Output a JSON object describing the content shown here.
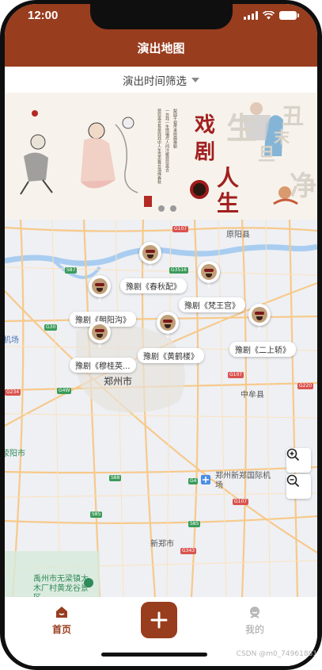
{
  "status_bar": {
    "time": "12:00"
  },
  "header": {
    "title": "演出地图"
  },
  "filter": {
    "label": "演出时间筛选"
  },
  "banner": {
    "title_chars": [
      "戏",
      "剧",
      "人",
      "生"
    ],
    "carousel_pages": 3,
    "active_page": 1
  },
  "map": {
    "place_labels": [
      {
        "name": "原阳县",
        "kind": "town"
      },
      {
        "name": "郑州市",
        "kind": "city"
      },
      {
        "name": "中牟县",
        "kind": "town"
      },
      {
        "name": "郑州新郑国际机场",
        "kind": "airport"
      },
      {
        "name": "新郑市",
        "kind": "town"
      },
      {
        "name": "禹州市无梁镇大木厂村黄龙谷景区",
        "kind": "scenic"
      },
      {
        "name": "荥阳市",
        "kind": "edge"
      },
      {
        "name": "机场",
        "kind": "edge"
      }
    ],
    "markers": [
      {
        "label": "豫剧《春秋配》"
      },
      {
        "label": "豫剧《梵王宫》"
      },
      {
        "label": "豫剧《朝阳沟》"
      },
      {
        "label": "豫剧《二上轿》"
      },
      {
        "label": "豫剧《黄鹤楼》"
      },
      {
        "label": "豫剧《穆桂英..."
      }
    ],
    "zoom_in_icon": "zoom-in-icon",
    "zoom_out_icon": "zoom-out-icon"
  },
  "tabbar": {
    "home_label": "首页",
    "add_icon": "plus-icon",
    "me_label": "我的"
  },
  "watermark": "CSDN @m0_74961881",
  "colors": {
    "brand": "#983d1e",
    "map_bg": "#eef0f4",
    "road": "#f7c98a",
    "water": "#a9cdf0"
  }
}
